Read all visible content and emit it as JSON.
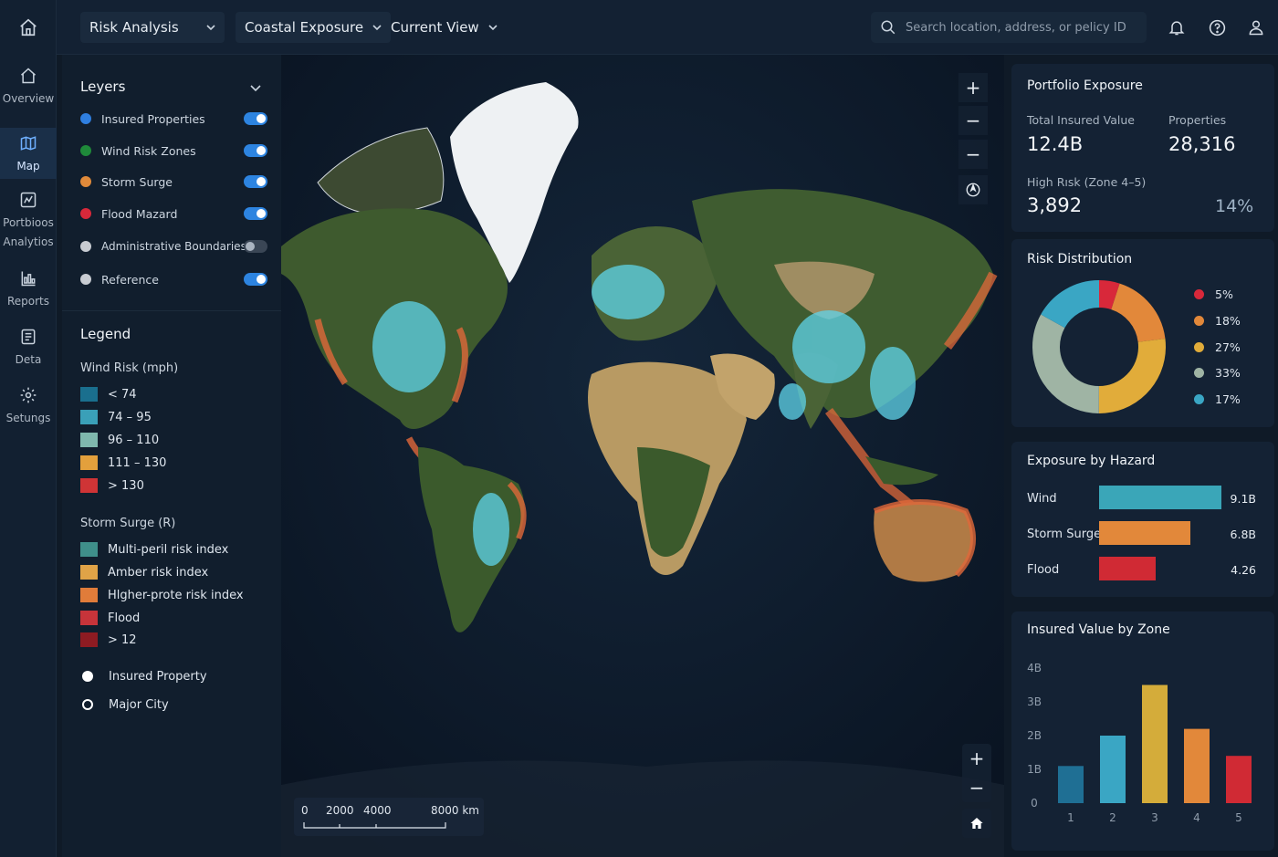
{
  "topbar": {
    "dropdowns": [
      "Risk Analysis",
      "Coastal Exposure",
      "Current View"
    ],
    "search_placeholder": "Search location, address, or pelicy ID"
  },
  "nav": {
    "items": [
      {
        "label": "Overview",
        "icon": "home-icon"
      },
      {
        "label": "Map",
        "icon": "map-icon",
        "active": true
      },
      {
        "label": "Portbioos\nAnalytios",
        "icon": "portfolio-icon"
      },
      {
        "label": "Reports",
        "icon": "reports-icon"
      },
      {
        "label": "Deta",
        "icon": "data-icon"
      },
      {
        "label": "Setungs",
        "icon": "settings-icon"
      }
    ]
  },
  "layers": {
    "title": "Leyers",
    "items": [
      {
        "label": "Insured Properties",
        "color": "#2f7fe0",
        "on": true
      },
      {
        "label": "Wind Risk Zones",
        "color": "#1f8a3a",
        "on": true
      },
      {
        "label": "Storm Surge",
        "color": "#e08a3a",
        "on": true
      },
      {
        "label": "Flood Mazard",
        "color": "#d8283a",
        "on": true
      },
      {
        "label": "Administrative Boundaries",
        "color": "#c8ccd2",
        "on": false
      },
      {
        "label": "Reference",
        "color": "#c8ccd2",
        "on": true
      }
    ]
  },
  "legend": {
    "title": "Legend",
    "wind_title": "Wind Risk (mph)",
    "wind": [
      {
        "label": "< 74",
        "color": "#1a6f8e"
      },
      {
        "label": "74 – 95",
        "color": "#3aa0b8"
      },
      {
        "label": "96 – 110",
        "color": "#7fb8ae"
      },
      {
        "label": "111 – 130",
        "color": "#e3a03c"
      },
      {
        "label": "> 130",
        "color": "#cf3436"
      }
    ],
    "surge_title": "Storm Surge (R)",
    "surge": [
      {
        "label": "Multi-peril risk index",
        "color": "#3f8f8a"
      },
      {
        "label": "Amber risk index",
        "color": "#e0a347"
      },
      {
        "label": "Hlgher-prote risk index",
        "color": "#e07c3a"
      },
      {
        "label": "Flood",
        "color": "#c7343a"
      },
      {
        "label": "> 12",
        "color": "#8e1b22"
      }
    ],
    "insured_property": "Insured Property",
    "major_city": "Major City"
  },
  "map": {
    "scale_labels": [
      "0",
      "2000",
      "4000",
      "8000 km"
    ]
  },
  "portfolio": {
    "title": "Portfolio Exposure",
    "tiv_label": "Total Insured Value",
    "tiv_value": "12.4B",
    "props_label": "Properties",
    "props_value": "28,316",
    "high_label": "High Rısk (Zone 4–5)",
    "high_value": "3,892",
    "high_pct": "14%"
  },
  "risk_distribution": {
    "title": "Risk Distribution",
    "slices": [
      {
        "label": "5%",
        "value": 5,
        "color": "#d8283a"
      },
      {
        "label": "18%",
        "value": 18,
        "color": "#e2883a"
      },
      {
        "label": "27%",
        "value": 27,
        "color": "#e1ac3a"
      },
      {
        "label": "33%",
        "value": 33,
        "color": "#9fb4a4"
      },
      {
        "label": "17%",
        "value": 17,
        "color": "#3aa6c4"
      }
    ]
  },
  "exposure_by_hazard": {
    "title": "Exposure by Hazard",
    "items": [
      {
        "label": "Wind",
        "value": 9.1,
        "display": "9.1B",
        "color": "#3aa6b8"
      },
      {
        "label": "Storm Surge",
        "value": 6.8,
        "display": "6.8B",
        "color": "#e2883a"
      },
      {
        "label": "Flood",
        "value": 4.2,
        "display": "4.26",
        "color": "#d02a34"
      }
    ]
  },
  "chart_data": {
    "type": "bar",
    "title": "Insured Value by Zone",
    "categories": [
      "1",
      "2",
      "3",
      "4",
      "5"
    ],
    "values": [
      1.1,
      2.0,
      3.5,
      2.2,
      1.4
    ],
    "colors": [
      "#1f6f94",
      "#3aa6c4",
      "#d4ac3a",
      "#e2883a",
      "#d02a34"
    ],
    "y_ticks": [
      "0",
      "1B",
      "2B",
      "3B",
      "4B"
    ],
    "ylim": [
      0,
      4
    ]
  }
}
